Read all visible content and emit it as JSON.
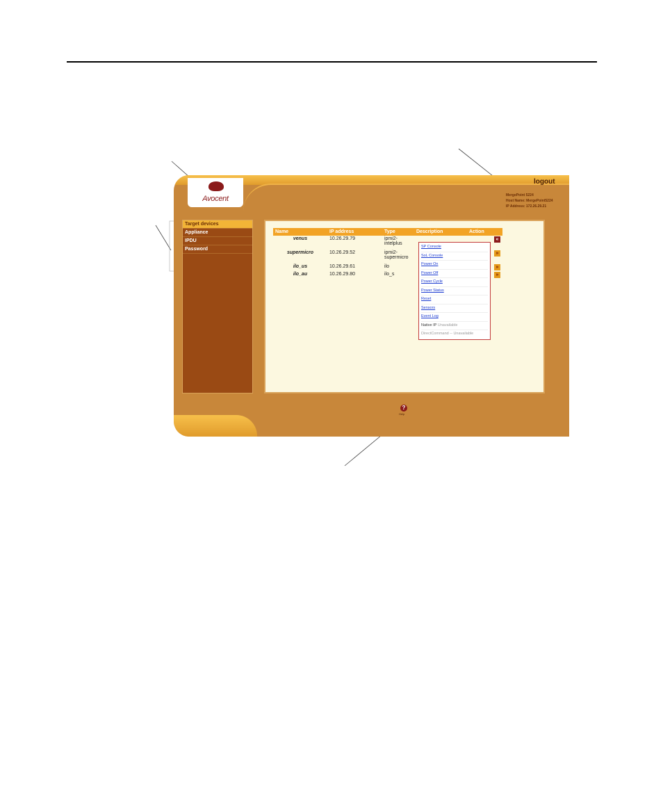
{
  "header": {
    "logo_text": "Avocent",
    "logout_label": "logout",
    "info_lines": [
      "MergePoint 5224",
      "Host Name: MergePoint5224",
      "IP Address: 172.26.29.21"
    ]
  },
  "sidebar": {
    "items": [
      {
        "label": "Target devices",
        "active": true
      },
      {
        "label": "Appliance"
      },
      {
        "label": "IPDU"
      },
      {
        "label": "Password"
      }
    ]
  },
  "table": {
    "headers": [
      "Name",
      "IP address",
      "Type",
      "Description",
      "Action"
    ],
    "rows": [
      {
        "name": "venus",
        "ip": "10.26.29.79",
        "type": "ipmi2-intelplus",
        "description": ""
      },
      {
        "name": "supermicro",
        "ip": "10.26.29.52",
        "type": "ipmi2-supermicro",
        "description": ""
      },
      {
        "name": "ilo_us",
        "ip": "10.26.29.61",
        "type": "ilo",
        "description": ""
      },
      {
        "name": "ilo_au",
        "ip": "10.26.29.80",
        "type": "ilo_s",
        "description": ""
      }
    ]
  },
  "action_menu": {
    "items": [
      "SP Console",
      "SoL Console",
      "Power On",
      "Power Off",
      "Power Cycle",
      "Power Status",
      "Reset",
      "Sensors",
      "Event Log"
    ],
    "native_ip_label": "Native IP",
    "native_ip_status": "Unavailable",
    "direct_command": "DirectCommand -- Unavailable"
  },
  "footer": {
    "help_label": "Help"
  },
  "icons": {
    "open_action": "collapse-arrow-icon",
    "closed_action": "expand-arrow-icon",
    "help": "help-icon"
  },
  "colors": {
    "accent": "#f2a325",
    "sidebar": "#9a4a14",
    "frame": "#c8873a"
  }
}
